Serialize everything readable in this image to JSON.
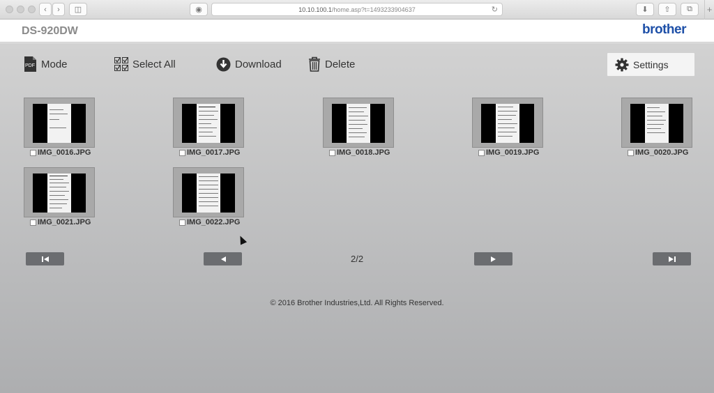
{
  "browser": {
    "url_host": "10.10.100.1",
    "url_path": "/home.asp?t=1493233904637"
  },
  "header": {
    "model": "DS-920DW",
    "brand": "brother"
  },
  "toolbar": {
    "mode_label": "Mode",
    "mode_icon_text": "PDF",
    "select_all_label": "Select All",
    "download_label": "Download",
    "delete_label": "Delete",
    "settings_label": "Settings"
  },
  "files": [
    {
      "name": "IMG_0016.JPG"
    },
    {
      "name": "IMG_0017.JPG"
    },
    {
      "name": "IMG_0018.JPG"
    },
    {
      "name": "IMG_0019.JPG"
    },
    {
      "name": "IMG_0020.JPG"
    },
    {
      "name": "IMG_0021.JPG"
    },
    {
      "name": "IMG_0022.JPG"
    }
  ],
  "pagination": {
    "first_icon": "first-page-icon",
    "prev_icon": "prev-page-icon",
    "next_icon": "next-page-icon",
    "last_icon": "last-page-icon",
    "page_label": "2/2"
  },
  "footer": {
    "copyright": "© 2016 Brother Industries,Ltd. All Rights Reserved."
  },
  "colors": {
    "brand": "#1e50a8",
    "pager_button": "#6b6d70"
  }
}
